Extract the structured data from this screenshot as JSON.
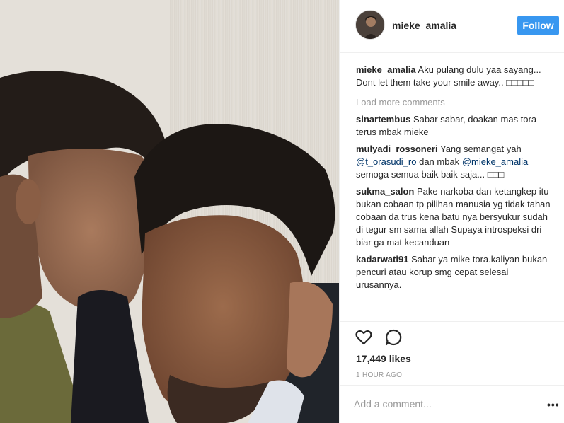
{
  "photo": {
    "description_icon": "photo-image"
  },
  "header": {
    "username": "mieke_amalia",
    "follow_label": "Follow",
    "follow_color": "#3897f0"
  },
  "caption": {
    "user": "mieke_amalia",
    "text": "Aku pulang dulu yaa sayang... Dont let them take your smile away.. □□□□□"
  },
  "load_more": "Load more comments",
  "comments": [
    {
      "user": "sinartembus",
      "text": "Sabar sabar, doakan mas tora terus mbak mieke"
    },
    {
      "user": "mulyadi_rossoneri",
      "text_before": "Yang semangat yah",
      "mention1": "@t_orasudi_ro",
      "text_mid": "dan mbak",
      "mention2": "@mieke_amalia",
      "text_after": "semoga semua baik baik saja... □□□"
    },
    {
      "user": "sukma_salon",
      "text": "Pake narkoba dan ketangkep itu bukan cobaan tp pilihan manusia yg tidak tahan cobaan da trus kena batu nya bersyukur sudah di tegur sm sama allah Supaya introspeksi dri biar ga mat kecanduan"
    },
    {
      "user": "kadarwati91",
      "text": "Sabar ya mike tora.kaliyan bukan pencuri atau korup smg cepat selesai urusannya."
    }
  ],
  "likes": "17,449 likes",
  "timestamp": "1 HOUR AGO",
  "add_comment": {
    "placeholder": "Add a comment..."
  },
  "more_label": "•••"
}
